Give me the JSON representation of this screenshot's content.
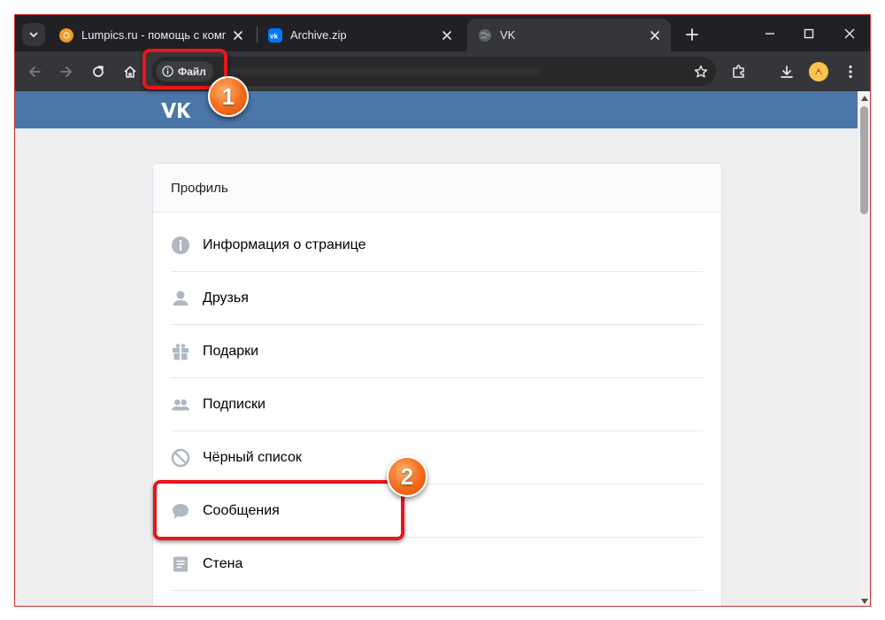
{
  "browser": {
    "tabs": [
      {
        "title": "Lumpics.ru - помощь с компьютером",
        "favicon": "orange-circle-icon",
        "active": false
      },
      {
        "title": "Archive.zip",
        "favicon": "vk-icon",
        "active": false
      },
      {
        "title": "VK",
        "favicon": "globe-icon",
        "active": true
      }
    ],
    "address_chip": "Файл"
  },
  "page": {
    "section_title": "Профиль",
    "menu": [
      {
        "label": "Информация о странице",
        "icon": "info-icon"
      },
      {
        "label": "Друзья",
        "icon": "person-icon"
      },
      {
        "label": "Подарки",
        "icon": "gift-icon"
      },
      {
        "label": "Подписки",
        "icon": "people-icon"
      },
      {
        "label": "Чёрный список",
        "icon": "block-icon"
      },
      {
        "label": "Сообщения",
        "icon": "message-icon"
      },
      {
        "label": "Стена",
        "icon": "wall-icon"
      }
    ]
  },
  "annotations": {
    "marker_1": "1",
    "marker_2": "2"
  },
  "colors": {
    "vk_header": "#4a76a8",
    "highlight": "#e8161b",
    "marker": "#f26a1a"
  }
}
